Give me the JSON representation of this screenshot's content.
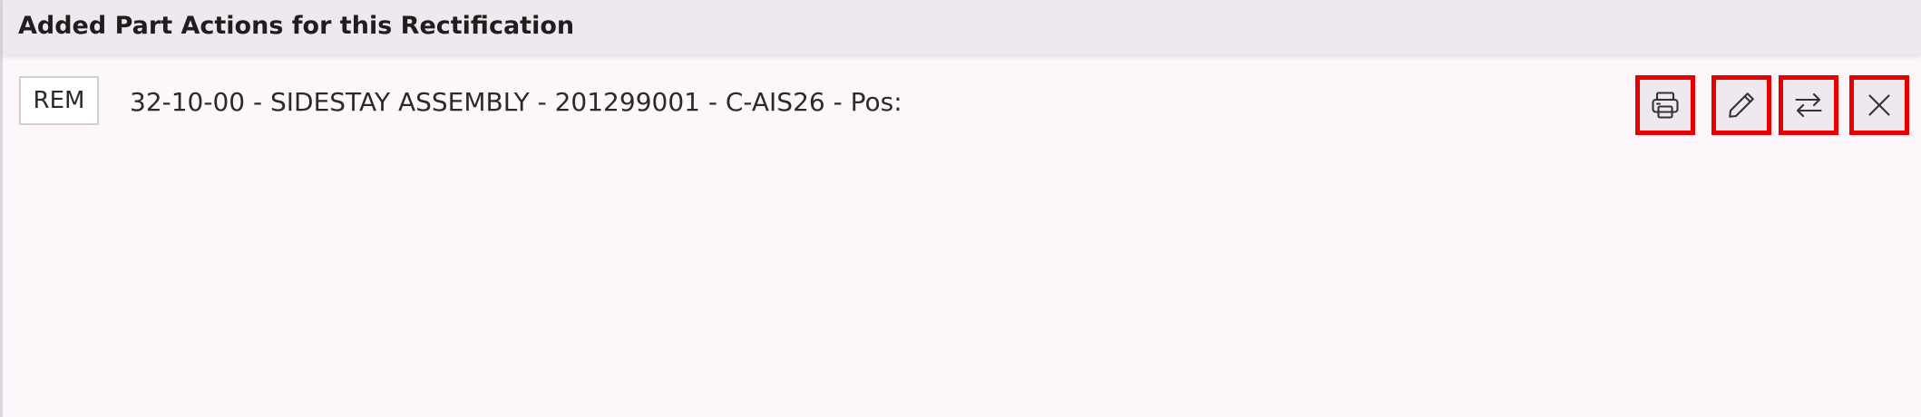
{
  "panel": {
    "title": "Added Part Actions for this Rectification"
  },
  "part_actions": [
    {
      "action_code": "REM",
      "description": "32-10-00 - SIDESTAY ASSEMBLY - 201299001 - C-AIS26 - Pos:",
      "buttons": [
        {
          "icon": "printer-icon"
        },
        {
          "icon": "pencil-icon"
        },
        {
          "icon": "swap-arrows-icon"
        },
        {
          "icon": "close-icon"
        }
      ]
    }
  ],
  "colors": {
    "panel_background": "#fdf7fb",
    "header_background": "#efe9ef",
    "highlight_border": "#e60000",
    "text": "#2a2a2a"
  }
}
